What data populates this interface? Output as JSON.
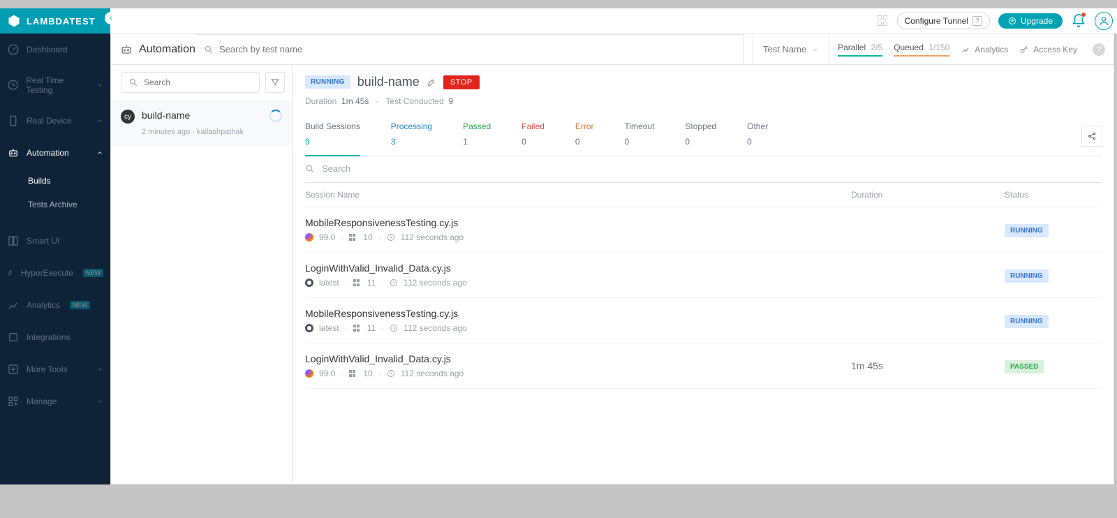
{
  "brand": "LAMBDATEST",
  "top": {
    "configure": "Configure Tunnel",
    "upgrade": "Upgrade"
  },
  "nav": {
    "dashboard": "Dashboard",
    "realtime": "Real Time Testing",
    "realdevice": "Real Device",
    "automation": "Automation",
    "builds": "Builds",
    "archive": "Tests Archive",
    "smartui": "Smart UI",
    "hyper": "HyperExecute",
    "analytics": "Analytics",
    "integrations": "Integrations",
    "moretools": "More Tools",
    "manage": "Manage",
    "new": "NEW"
  },
  "head": {
    "title": "Automation",
    "search_ph": "Search by test name",
    "dropdown": "Test Name",
    "parallel_lbl": "Parallel",
    "parallel_val": "2/5",
    "queued_lbl": "Queued",
    "queued_val": "1/150",
    "analytics": "Analytics",
    "accesskey": "Access Key"
  },
  "left": {
    "search_ph": "Search",
    "build": "build-name",
    "time": "2 minutes ago",
    "user": "kailashpathak"
  },
  "build": {
    "status": "RUNNING",
    "name": "build-name",
    "stop": "STOP",
    "dur_lbl": "Duration",
    "dur_val": "1m 45s",
    "cond_lbl": "Test Conducted",
    "cond_val": "9"
  },
  "tabs": {
    "sessions_lbl": "Build Sessions",
    "sessions_val": "9",
    "processing_lbl": "Processing",
    "processing_val": "3",
    "passed_lbl": "Passed",
    "passed_val": "1",
    "failed_lbl": "Failed",
    "failed_val": "0",
    "error_lbl": "Error",
    "error_val": "0",
    "timeout_lbl": "Timeout",
    "timeout_val": "0",
    "stopped_lbl": "Stopped",
    "stopped_val": "0",
    "other_lbl": "Other",
    "other_val": "0"
  },
  "sessSearch": "Search",
  "cols": {
    "name": "Session Name",
    "dur": "Duration",
    "status": "Status"
  },
  "rows": [
    {
      "name": "MobileResponsivenessTesting.cy.js",
      "browser": "ff",
      "bver": "99.0",
      "os": "10",
      "ago": "112 seconds ago",
      "dur": "",
      "status": "RUNNING"
    },
    {
      "name": "LoginWithValid_Invalid_Data.cy.js",
      "browser": "cr",
      "bver": "latest",
      "os": "11",
      "ago": "112 seconds ago",
      "dur": "",
      "status": "RUNNING"
    },
    {
      "name": "MobileResponsivenessTesting.cy.js",
      "browser": "cr",
      "bver": "latest",
      "os": "11",
      "ago": "112 seconds ago",
      "dur": "",
      "status": "RUNNING"
    },
    {
      "name": "LoginWithValid_Invalid_Data.cy.js",
      "browser": "ff",
      "bver": "99.0",
      "os": "10",
      "ago": "112 seconds ago",
      "dur": "1m 45s",
      "status": "PASSED"
    }
  ]
}
